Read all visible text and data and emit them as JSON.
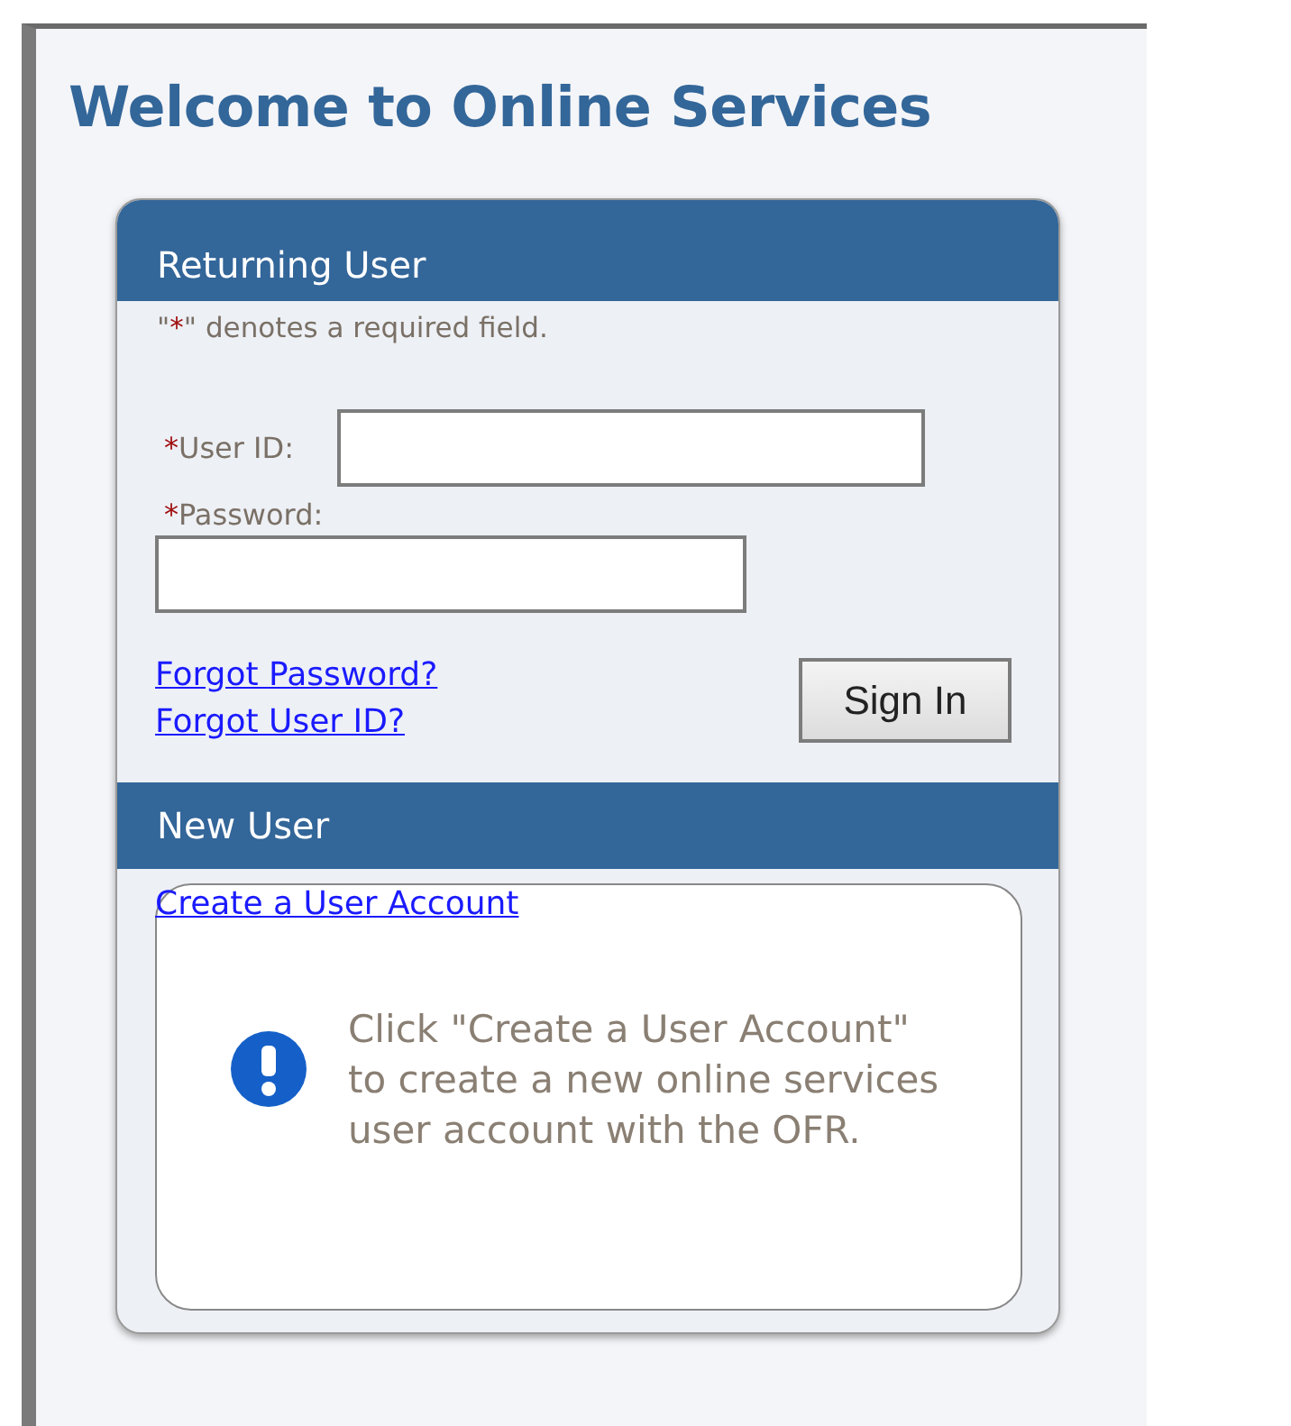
{
  "title": "Welcome to Online Services",
  "returning_user": {
    "heading": "Returning User",
    "required_note": {
      "before": "\"",
      "mark": "*",
      "after": "\" denotes a required field."
    },
    "fields": [
      {
        "mark": "*",
        "label": "User ID:"
      },
      {
        "mark": "*",
        "label": "Password:"
      }
    ],
    "links": [
      "Forgot Password?",
      "Forgot User ID?"
    ],
    "button": "Sign In"
  },
  "new_user": {
    "heading": "New User",
    "link": "Create a User Account",
    "message": "Click \"Create a User Account\" to create a new online services user account with the OFR."
  }
}
